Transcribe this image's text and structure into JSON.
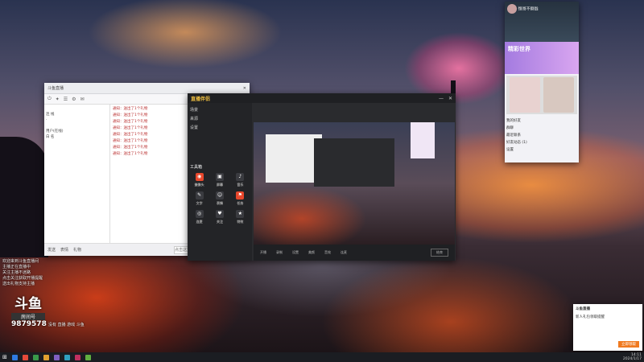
{
  "colors": {
    "accent": "#e8472c",
    "qq_banner": "#b487e6",
    "taskbar": "#1b1d22",
    "popup_button": "#f07a20"
  },
  "chat": {
    "title": "斗鱼直播",
    "toolbar": [
      "⏻",
      "✦",
      "☰",
      "⚙",
      "✉"
    ],
    "contacts": [
      "",
      "连 线",
      "·",
      "",
      "用户(在线)",
      "白 名",
      "",
      ""
    ],
    "messages": [
      "通知：送出了1个礼物",
      "通知：送出了1个礼物",
      "通知：送出了1个礼物",
      "通知：送出了1个礼物",
      "通知：送出了1个礼物",
      "通知：送出了1个礼物",
      "通知：送出了1个礼物",
      "通知：送出了1个礼物"
    ],
    "bottom_items": [
      "发送",
      "表情",
      "礼物"
    ],
    "input_placeholder": "点击这里发言"
  },
  "obs": {
    "app_name": "直播伴侣",
    "sidebar_items": [
      "场景",
      "来源",
      "设置"
    ],
    "tools_title": "工具箱",
    "tools": [
      {
        "icon": "◉",
        "label": "摄像头"
      },
      {
        "icon": "▣",
        "label": "屏幕"
      },
      {
        "icon": "♪",
        "label": "音乐"
      },
      {
        "icon": "✎",
        "label": "文字"
      },
      {
        "icon": "☺",
        "label": "表情"
      },
      {
        "icon": "⚑",
        "label": "任务"
      },
      {
        "icon": "◎",
        "label": "连麦"
      },
      {
        "icon": "♥",
        "label": "关注"
      },
      {
        "icon": "★",
        "label": "特效"
      }
    ],
    "controls": [
      "开播",
      "录制",
      "设置",
      "美颜",
      "音效",
      "连麦"
    ],
    "stop_label": "结束"
  },
  "qq": {
    "nickname": "恒哥不倒翁",
    "banner_text": "精彩世界",
    "list_items": [
      "我的好友",
      "群聊",
      "最近联系",
      "好友动态 (1)",
      "设置"
    ]
  },
  "popup": {
    "title": "斗鱼直播",
    "text": "新人礼包领取提醒",
    "button": "立即领取"
  },
  "overlay": {
    "lines": [
      "欢迎来到斗鱼直播间",
      "主播正在直播中",
      "关注主播不迷路",
      "点击关注获取开播提醒",
      "送出礼物支持主播"
    ],
    "bottom_line": "没有 直播 游戏 斗鱼"
  },
  "brand": {
    "logo": "斗鱼",
    "room_label": "房间号",
    "room_number": "9879578"
  },
  "taskbar": {
    "clock_time": "14:11",
    "clock_date": "2024/1/17",
    "icons": [
      "#2f7be0",
      "#e34a3a",
      "#3a9a4a",
      "#e0a030",
      "#8060c0",
      "#30a0c0",
      "#c03060",
      "#60b040"
    ]
  }
}
